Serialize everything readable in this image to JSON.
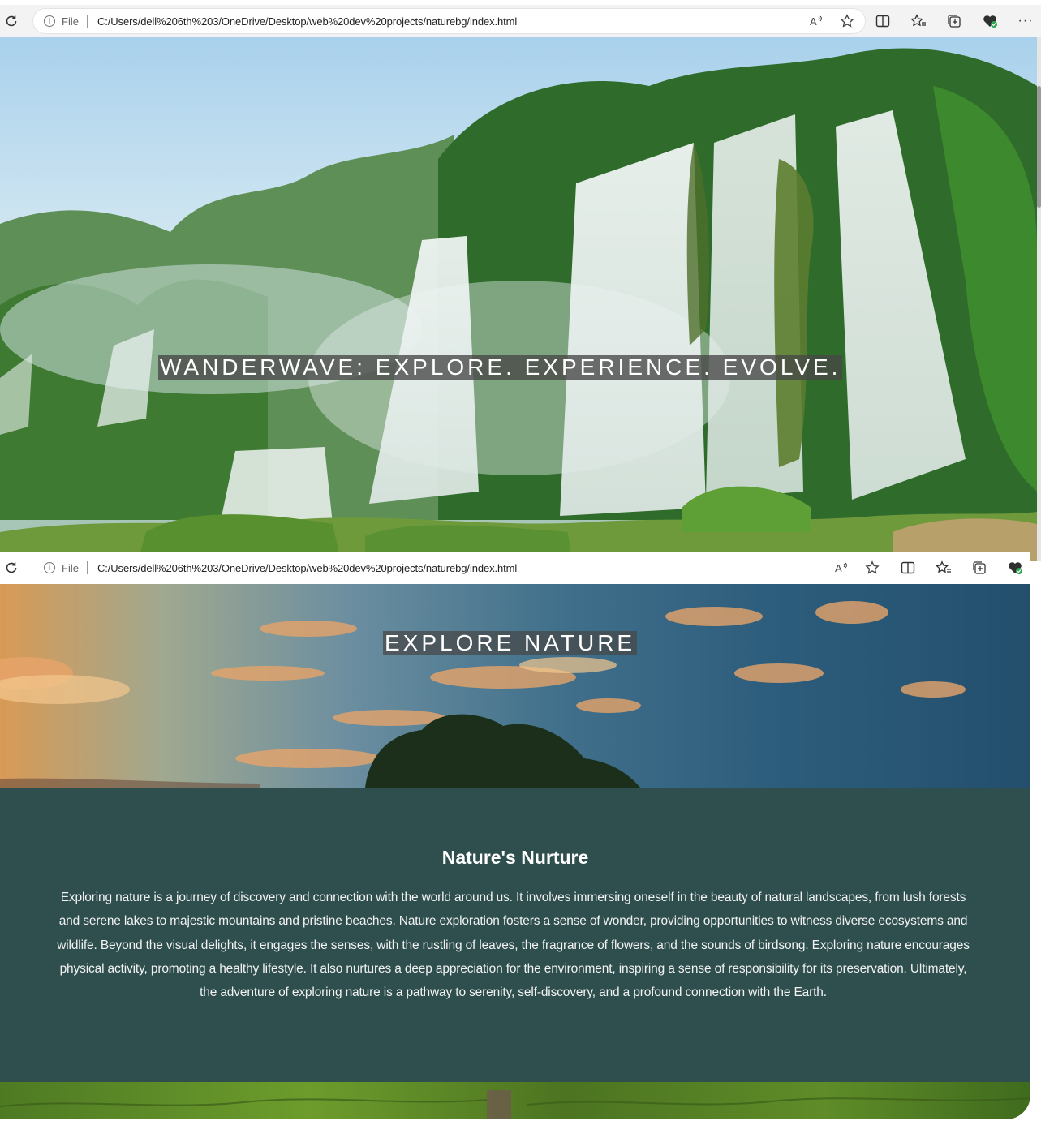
{
  "browser": {
    "file_label": "File",
    "url": "C:/Users/dell%206th%203/OneDrive/Desktop/web%20dev%20projects/naturebg/index.html",
    "menu_label": "···"
  },
  "hero": {
    "title": "WANDERWAVE: EXPLORE. EXPERIENCE. EVOLVE."
  },
  "explore": {
    "title": "EXPLORE NATURE"
  },
  "article": {
    "heading": "Nature's Nurture",
    "body": "Exploring nature is a journey of discovery and connection with the world around us. It involves immersing oneself in the beauty of natural landscapes, from lush forests and serene lakes to majestic mountains and pristine beaches. Nature exploration fosters a sense of wonder, providing opportunities to witness diverse ecosystems and wildlife. Beyond the visual delights, it engages the senses, with the rustling of leaves, the fragrance of flowers, and the sounds of birdsong. Exploring nature encourages physical activity, promoting a healthy lifestyle. It also nurtures a deep appreciation for the environment, inspiring a sense of responsibility for its preservation. Ultimately, the adventure of exploring nature is a pathway to serenity, self-discovery, and a profound connection with the Earth."
  },
  "colors": {
    "panel_background": "#2f4f4f",
    "title_highlight": "#464646"
  },
  "icons": [
    "reload-icon",
    "info-icon",
    "read-aloud-icon",
    "favorite-star-icon",
    "split-screen-icon",
    "favorites-icon",
    "collections-icon",
    "browser-essentials-icon",
    "more-menu-icon"
  ]
}
